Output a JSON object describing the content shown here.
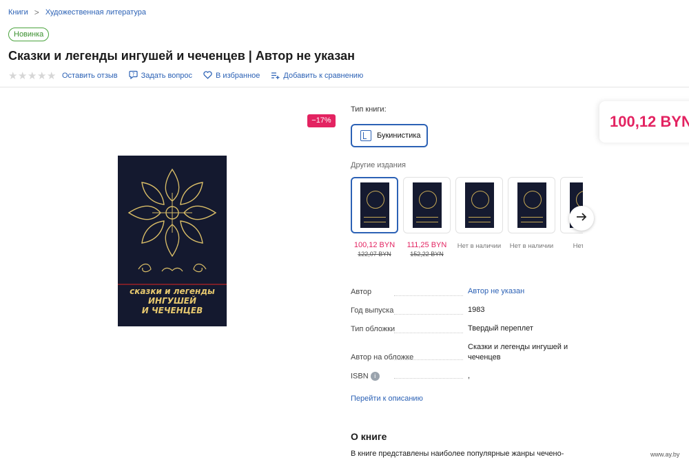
{
  "breadcrumb": [
    "Книги",
    "Художественная литература"
  ],
  "badge": "Новинка",
  "title": "Сказки и легенды ингушей и чеченцев | Автор не указан",
  "rating": {
    "value": 0,
    "max": 5
  },
  "actions": {
    "review": "Оставить отзыв",
    "question": "Задать вопрос",
    "favorite": "В избранное",
    "compare": "Добавить к сравнению"
  },
  "discount": "−17%",
  "cover": {
    "line1": "сказки и легенды",
    "line2": "ингушей",
    "line3": "и чеченцев"
  },
  "book_type": {
    "label": "Тип книги:",
    "value": "Букинистика"
  },
  "other_editions": {
    "label": "Другие издания",
    "items": [
      {
        "price": "100,12 BYN",
        "old_price": "122,07 BYN",
        "status": ""
      },
      {
        "price": "111,25 BYN",
        "old_price": "152,22 BYN",
        "status": ""
      },
      {
        "price": "",
        "old_price": "",
        "status": "Нет в наличии"
      },
      {
        "price": "",
        "old_price": "",
        "status": "Нет в наличии"
      },
      {
        "price": "",
        "old_price": "",
        "status": "Нет в н"
      }
    ]
  },
  "specs": {
    "author_label": "Автор",
    "author_value": "Автор не указан",
    "year_label": "Год выпуска",
    "year_value": "1983",
    "cover_label": "Тип обложки",
    "cover_value": "Твердый переплет",
    "cover_author_label": "Автор на обложке",
    "cover_author_value_1": "Сказки и легенды ингушей и",
    "cover_author_value_2": "чеченцев",
    "isbn_label": "ISBN",
    "isbn_value": ","
  },
  "desc_link": "Перейти к описанию",
  "about": {
    "title": "О книге",
    "text": "В книге представлены наиболее популярные жанры чечено-"
  },
  "price": "100,12 BYN",
  "watermark": "www.ay.by",
  "colors": {
    "accent": "#2b61b5",
    "price": "#e32361",
    "new_badge": "#49a33c"
  }
}
